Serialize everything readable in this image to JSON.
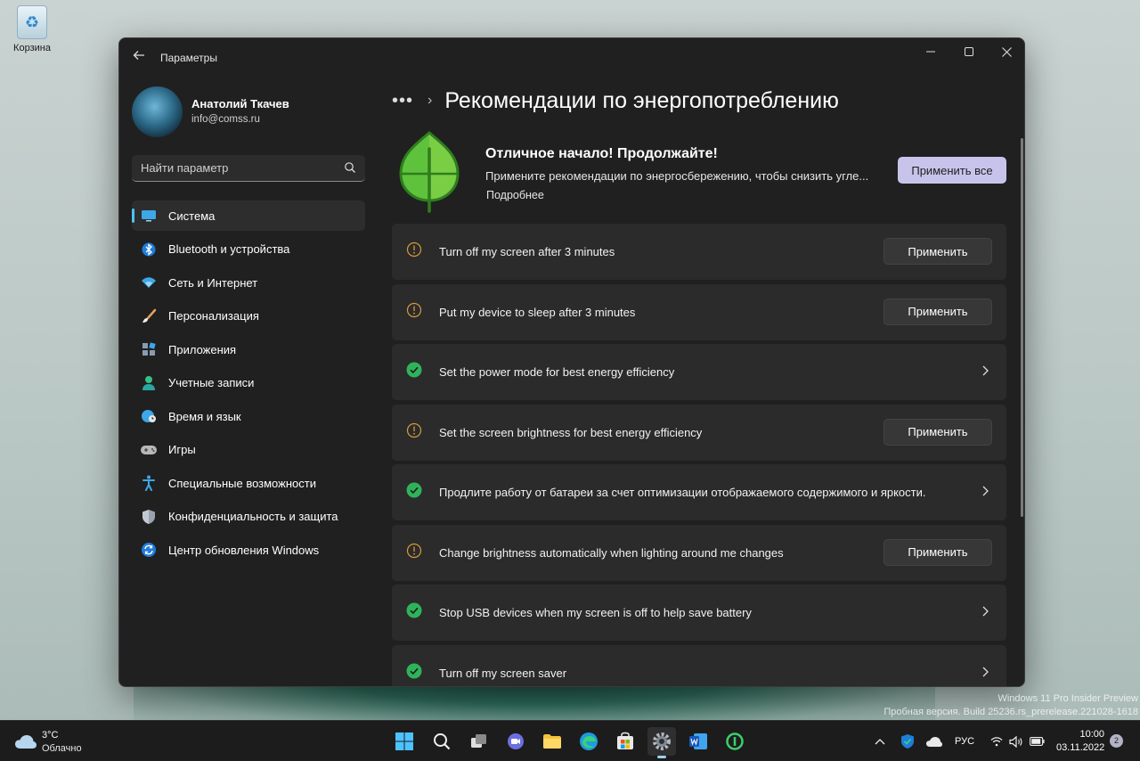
{
  "desktop": {
    "recycle_bin_label": "Корзина",
    "watermark_line1": "Windows 11 Pro Insider Preview",
    "watermark_line2": "Пробная версия. Build 25236.rs_prerelease.221028-1618"
  },
  "window": {
    "app_title": "Параметры"
  },
  "profile": {
    "name": "Анатолий Ткачев",
    "email": "info@comss.ru"
  },
  "search": {
    "placeholder": "Найти параметр"
  },
  "sidebar": {
    "items": [
      {
        "label": "Система",
        "icon": "monitor-icon",
        "active": true
      },
      {
        "label": "Bluetooth и устройства",
        "icon": "bluetooth-icon"
      },
      {
        "label": "Сеть и Интернет",
        "icon": "wifi-icon"
      },
      {
        "label": "Персонализация",
        "icon": "brush-icon"
      },
      {
        "label": "Приложения",
        "icon": "apps-icon"
      },
      {
        "label": "Учетные записи",
        "icon": "person-icon"
      },
      {
        "label": "Время и язык",
        "icon": "globe-clock-icon"
      },
      {
        "label": "Игры",
        "icon": "gamepad-icon"
      },
      {
        "label": "Специальные возможности",
        "icon": "accessibility-icon"
      },
      {
        "label": "Конфиденциальность и защита",
        "icon": "shield-icon"
      },
      {
        "label": "Центр обновления Windows",
        "icon": "update-icon"
      }
    ]
  },
  "main": {
    "breadcrumb_more": "•••",
    "breadcrumb_sep": "›",
    "page_title": "Рекомендации по энергопотреблению",
    "hero": {
      "title": "Отличное начало! Продолжайте!",
      "description": "Примените рекомендации по энергосбережению, чтобы снизить угле...",
      "link": "Подробнее",
      "apply_all_label": "Применить все"
    },
    "recommendations": [
      {
        "label": "Turn off my screen after 3 minutes",
        "status": "warning",
        "action": "Применить"
      },
      {
        "label": "Put my device to sleep after 3 minutes",
        "status": "warning",
        "action": "Применить"
      },
      {
        "label": "Set the power mode for best energy efficiency",
        "status": "done",
        "action": ""
      },
      {
        "label": "Set the screen brightness for best energy efficiency",
        "status": "warning",
        "action": "Применить"
      },
      {
        "label": "Продлите работу от батареи за счет оптимизации отображаемого содержимого и яркости.",
        "status": "done",
        "action": ""
      },
      {
        "label": "Change brightness automatically when lighting around me changes",
        "status": "warning",
        "action": "Применить"
      },
      {
        "label": "Stop USB devices when my screen is off to help save battery",
        "status": "done",
        "action": ""
      },
      {
        "label": "Turn off my screen saver",
        "status": "done",
        "action": ""
      }
    ]
  },
  "taskbar": {
    "weather_temp": "3°C",
    "weather_condition": "Облачно",
    "language": "РУС",
    "time": "10:00",
    "date": "03.11.2022",
    "notifications": "2",
    "apps": [
      "start-icon",
      "search-icon",
      "task-view-icon",
      "chat-icon",
      "file-explorer-icon",
      "edge-icon",
      "store-icon",
      "settings-icon",
      "word-icon",
      "app-icon"
    ]
  },
  "colors": {
    "accent": "#4cc2ff",
    "warning": "#d69a3a",
    "success": "#2fb35a",
    "apply_all_bg": "#c7c4ec"
  }
}
